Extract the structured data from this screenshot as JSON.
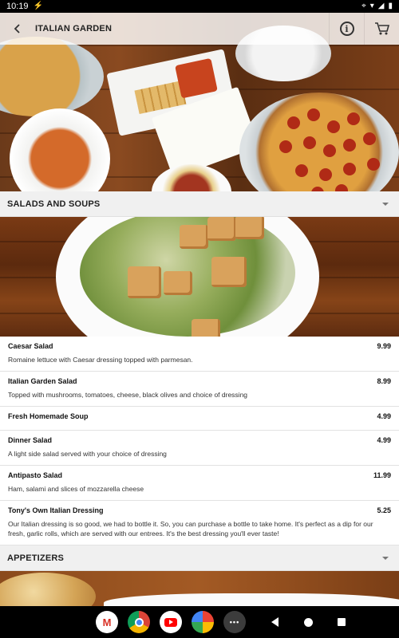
{
  "status_bar": {
    "time": "10:19",
    "icons": [
      "wifi-icon",
      "signal-icon",
      "battery-icon"
    ]
  },
  "app_bar": {
    "back_icon": "arrow-back-icon",
    "title": "ITALIAN GARDEN",
    "info_icon": "info-icon",
    "cart_icon": "cart-icon"
  },
  "sections": [
    {
      "label": "SALADS AND SOUPS",
      "items": [
        {
          "name": "Caesar Salad",
          "price": "9.99",
          "description": "Romaine lettuce with Caesar dressing topped with parmesan."
        },
        {
          "name": "Italian Garden Salad",
          "price": "8.99",
          "description": "Topped with mushrooms, tomatoes, cheese, black olives and choice of dressing"
        },
        {
          "name": "Fresh Homemade Soup",
          "price": "4.99",
          "description": ""
        },
        {
          "name": "Dinner Salad",
          "price": "4.99",
          "description": "A light side salad served with your choice of dressing"
        },
        {
          "name": "Antipasto Salad",
          "price": "11.99",
          "description": "Ham, salami and slices of mozzarella cheese"
        },
        {
          "name": "Tony's Own Italian Dressing",
          "price": "5.25",
          "description": "Our Italian dressing is so good, we had to bottle it. So, you can purchase a bottle to take home. It's perfect as a dip for our fresh, garlic rolls, which are served with our entrees. It's the best dressing you'll ever taste!"
        }
      ]
    },
    {
      "label": "APPETIZERS",
      "items": []
    }
  ],
  "nav_bar": {
    "apps": [
      "gmail-icon",
      "chrome-icon",
      "youtube-icon",
      "photos-icon",
      "app-drawer-icon"
    ],
    "buttons": [
      "back-nav-button",
      "home-nav-button",
      "recents-nav-button"
    ]
  }
}
